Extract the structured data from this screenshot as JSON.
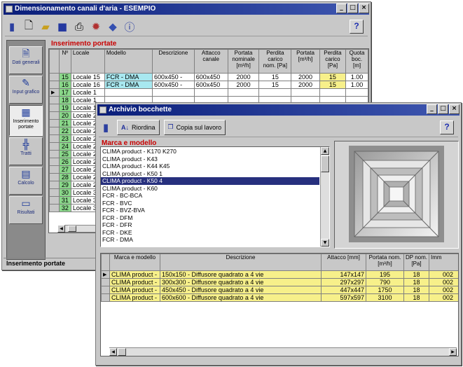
{
  "main": {
    "title": "Dimensionamento canali d'aria - ESEMPIO",
    "help": "?",
    "statusbar": "Inserimento portate",
    "sidebar": [
      {
        "label": "Dati generali",
        "icon": "document-icon"
      },
      {
        "label": "Input grafico",
        "icon": "graphic-input-icon"
      },
      {
        "label": "Inserimento portate",
        "icon": "table-icon"
      },
      {
        "label": "Tratti",
        "icon": "ducts-icon"
      },
      {
        "label": "Calcolo",
        "icon": "calculator-icon"
      },
      {
        "label": "Risultati",
        "icon": "results-icon"
      }
    ],
    "section_title": "Inserimento portate",
    "columns": [
      "Nº",
      "Locale",
      "Modello",
      "Descrizione",
      "Attacco canale",
      "Portata nominale [m³/h]",
      "Perdita carico nom. [Pa]",
      "Portata [m³/h]",
      "Perdita carico [Pa]",
      "Quota boc. [m]"
    ],
    "rows": [
      {
        "n": "15",
        "locale": "Locale 15",
        "modello": "FCR - DMA",
        "descr": "600x450 -",
        "attacco": "600x450",
        "portata_nom": "2000",
        "perdita_nom": "15",
        "portata": "2000",
        "perdita": "15",
        "quota": "1.00"
      },
      {
        "n": "16",
        "locale": "Locale 16",
        "modello": "FCR - DMA",
        "descr": "600x450 -",
        "attacco": "600x450",
        "portata_nom": "2000",
        "perdita_nom": "15",
        "portata": "2000",
        "perdita": "15",
        "quota": "1.00"
      },
      {
        "n": "17",
        "locale": "Locale 1",
        "modello": "",
        "descr": "",
        "attacco": "",
        "portata_nom": "",
        "perdita_nom": "",
        "portata": "",
        "perdita": "",
        "quota": ""
      },
      {
        "n": "18",
        "locale": "Locale 1",
        "modello": "",
        "descr": "",
        "attacco": "",
        "portata_nom": "",
        "perdita_nom": "",
        "portata": "",
        "perdita": "",
        "quota": ""
      },
      {
        "n": "19",
        "locale": "Locale 1",
        "modello": "",
        "descr": "",
        "attacco": "",
        "portata_nom": "",
        "perdita_nom": "",
        "portata": "",
        "perdita": "",
        "quota": ""
      },
      {
        "n": "20",
        "locale": "Locale 2",
        "modello": "",
        "descr": "",
        "attacco": "",
        "portata_nom": "",
        "perdita_nom": "",
        "portata": "",
        "perdita": "",
        "quota": ""
      },
      {
        "n": "21",
        "locale": "Locale 2",
        "modello": "",
        "descr": "",
        "attacco": "",
        "portata_nom": "",
        "perdita_nom": "",
        "portata": "",
        "perdita": "",
        "quota": ""
      },
      {
        "n": "22",
        "locale": "Locale 2",
        "modello": "",
        "descr": "",
        "attacco": "",
        "portata_nom": "",
        "perdita_nom": "",
        "portata": "",
        "perdita": "",
        "quota": ""
      },
      {
        "n": "23",
        "locale": "Locale 2",
        "modello": "",
        "descr": "",
        "attacco": "",
        "portata_nom": "",
        "perdita_nom": "",
        "portata": "",
        "perdita": "",
        "quota": ""
      },
      {
        "n": "24",
        "locale": "Locale 2",
        "modello": "",
        "descr": "",
        "attacco": "",
        "portata_nom": "",
        "perdita_nom": "",
        "portata": "",
        "perdita": "",
        "quota": ""
      },
      {
        "n": "25",
        "locale": "Locale 2",
        "modello": "",
        "descr": "",
        "attacco": "",
        "portata_nom": "",
        "perdita_nom": "",
        "portata": "",
        "perdita": "",
        "quota": ""
      },
      {
        "n": "26",
        "locale": "Locale 2",
        "modello": "",
        "descr": "",
        "attacco": "",
        "portata_nom": "",
        "perdita_nom": "",
        "portata": "",
        "perdita": "",
        "quota": ""
      },
      {
        "n": "27",
        "locale": "Locale 2",
        "modello": "",
        "descr": "",
        "attacco": "",
        "portata_nom": "",
        "perdita_nom": "",
        "portata": "",
        "perdita": "",
        "quota": ""
      },
      {
        "n": "28",
        "locale": "Locale 2",
        "modello": "",
        "descr": "",
        "attacco": "",
        "portata_nom": "",
        "perdita_nom": "",
        "portata": "",
        "perdita": "",
        "quota": ""
      },
      {
        "n": "29",
        "locale": "Locale 2",
        "modello": "",
        "descr": "",
        "attacco": "",
        "portata_nom": "",
        "perdita_nom": "",
        "portata": "",
        "perdita": "",
        "quota": ""
      },
      {
        "n": "30",
        "locale": "Locale 3",
        "modello": "",
        "descr": "",
        "attacco": "",
        "portata_nom": "",
        "perdita_nom": "",
        "portata": "",
        "perdita": "",
        "quota": ""
      },
      {
        "n": "31",
        "locale": "Locale 3",
        "modello": "",
        "descr": "",
        "attacco": "",
        "portata_nom": "",
        "perdita_nom": "",
        "portata": "",
        "perdita": "",
        "quota": ""
      },
      {
        "n": "32",
        "locale": "Locale 3",
        "modello": "",
        "descr": "",
        "attacco": "",
        "portata_nom": "",
        "perdita_nom": "",
        "portata": "",
        "perdita": "",
        "quota": ""
      }
    ]
  },
  "dialog": {
    "title": "Archivio bocchette",
    "help": "?",
    "buttons": {
      "sort": "Riordina",
      "copy": "Copia sul lavoro"
    },
    "list_title": "Marca e modello",
    "list": [
      "CLIMA product - K170 K270",
      "CLIMA product - K43",
      "CLIMA product - K44 K45",
      "CLIMA product - K50 1",
      "CLIMA product - K50 4",
      "CLIMA product - K60",
      "FCR - BC-BCA",
      "FCR - BVC",
      "FCR - BVZ-BVA",
      "FCR - DFM",
      "FCR - DFR",
      "FCR - DKE",
      "FCR - DMA"
    ],
    "list_selected": 4,
    "table_columns": [
      "Marca e modello",
      "Descrizione",
      "Attacco [mm]",
      "Portata nom. [m³/h]",
      "DP nom. [Pa]",
      "Imm"
    ],
    "table_rows": [
      {
        "marca": "CLIMA product -",
        "descr": "150x150 - Diffusore quadrato a 4 vie",
        "attacco": "147x147",
        "portata": "195",
        "dp": "18",
        "imm": "002"
      },
      {
        "marca": "CLIMA product -",
        "descr": "300x300 - Diffusore quadrato a 4 vie",
        "attacco": "297x297",
        "portata": "790",
        "dp": "18",
        "imm": "002"
      },
      {
        "marca": "CLIMA product -",
        "descr": "450x450 - Diffusore quadrato a 4 vie",
        "attacco": "447x447",
        "portata": "1750",
        "dp": "18",
        "imm": "002"
      },
      {
        "marca": "CLIMA product -",
        "descr": "600x600 - Diffusore quadrato a 4 vie",
        "attacco": "597x597",
        "portata": "3100",
        "dp": "18",
        "imm": "002"
      }
    ]
  },
  "colors": {
    "selection": "#27307e",
    "row_highlight": "#f7f08a",
    "number_green": "#8ad88a",
    "model_cyan": "#a8e8f0",
    "red_heading": "#c80000"
  }
}
